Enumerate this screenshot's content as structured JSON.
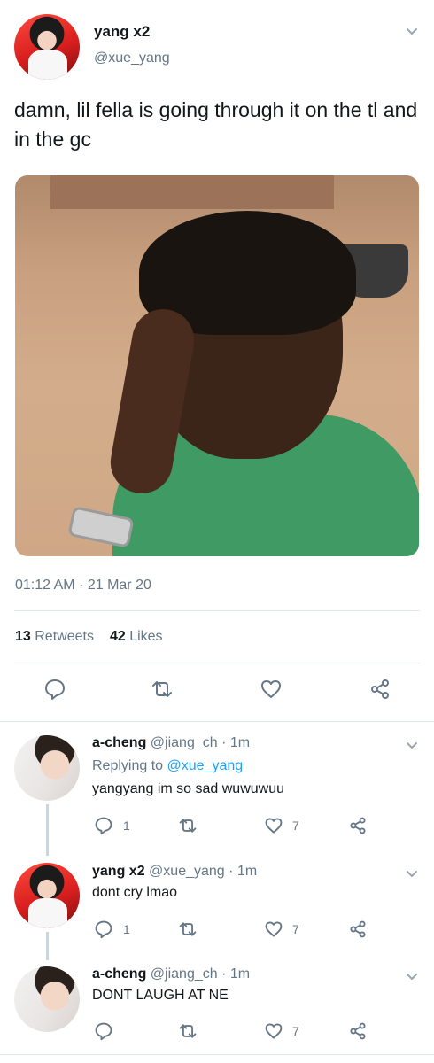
{
  "main_tweet": {
    "name": "yang x2",
    "handle": "@xue_yang",
    "text": "damn, lil fella is going through it on the tl and in the gc",
    "timestamp": "01:12 AM · 21 Mar 20",
    "retweets_count": "13",
    "retweets_label": "Retweets",
    "likes_count": "42",
    "likes_label": "Likes"
  },
  "replies": [
    {
      "name": "a-cheng",
      "handle": "@jiang_ch",
      "time": "· 1m",
      "replying_label": "Replying to",
      "replying_to": "@xue_yang",
      "text": "yangyang im so sad wuwuwuu",
      "reply_count": "1",
      "retweet_count": "",
      "like_count": "7"
    },
    {
      "name": "yang x2",
      "handle": "@xue_yang",
      "time": "· 1m",
      "text": "dont cry lmao",
      "reply_count": "1",
      "retweet_count": "",
      "like_count": "7"
    },
    {
      "name": "a-cheng",
      "handle": "@jiang_ch",
      "time": "· 1m",
      "text": "DONT LAUGH AT NE",
      "reply_count": "",
      "retweet_count": "",
      "like_count": "7"
    }
  ],
  "icons": {
    "reply": "reply-icon",
    "retweet": "retweet-icon",
    "like": "heart-icon",
    "share": "share-icon",
    "caret": "chevron-down-icon"
  },
  "colors": {
    "link": "#1da1f2",
    "secondary_text": "#657786",
    "primary_text": "#14171a",
    "divider": "#e1e8ed"
  }
}
